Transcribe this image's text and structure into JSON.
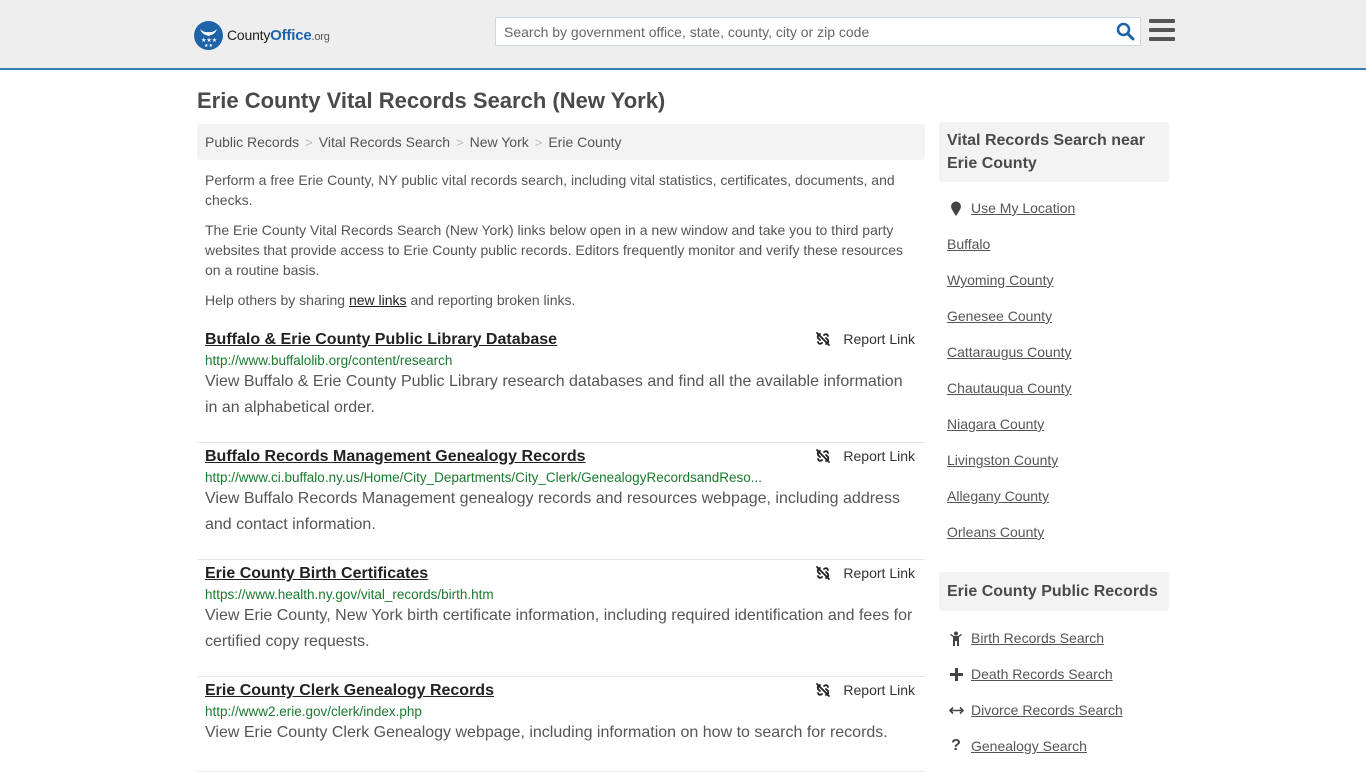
{
  "header": {
    "logo": {
      "county": "County",
      "office": "Office",
      "org": ".org"
    },
    "search_placeholder": "Search by government office, state, county, city or zip code"
  },
  "page_title": "Erie County Vital Records Search (New York)",
  "breadcrumb": [
    "Public Records",
    "Vital Records Search",
    "New York",
    "Erie County"
  ],
  "intro": {
    "p1": "Perform a free Erie County, NY public vital records search, including vital statistics, certificates, documents, and checks.",
    "p2": "The Erie County Vital Records Search (New York) links below open in a new window and take you to third party websites that provide access to Erie County public records. Editors frequently monitor and verify these resources on a routine basis.",
    "p3_before": "Help others by sharing ",
    "p3_link": "new links",
    "p3_after": " and reporting broken links."
  },
  "report_label": "Report Link",
  "results": [
    {
      "title": "Buffalo & Erie County Public Library Database",
      "url": "http://www.buffalolib.org/content/research",
      "description": "View Buffalo & Erie County Public Library research databases and find all the available information in an alphabetical order."
    },
    {
      "title": "Buffalo Records Management Genealogy Records",
      "url": "http://www.ci.buffalo.ny.us/Home/City_Departments/City_Clerk/GenealogyRecordsandReso...",
      "description": "View Buffalo Records Management genealogy records and resources webpage, including address and contact information."
    },
    {
      "title": "Erie County Birth Certificates",
      "url": "https://www.health.ny.gov/vital_records/birth.htm",
      "description": "View Erie County, New York birth certificate information, including required identification and fees for certified copy requests."
    },
    {
      "title": "Erie County Clerk Genealogy Records",
      "url": "http://www2.erie.gov/clerk/index.php",
      "description": "View Erie County Clerk Genealogy webpage, including information on how to search for records."
    }
  ],
  "sidebar": {
    "nearby": {
      "heading": "Vital Records Search near Erie County",
      "use_location": "Use My Location",
      "items": [
        "Buffalo",
        "Wyoming County",
        "Genesee County",
        "Cattaraugus County",
        "Chautauqua County",
        "Niagara County",
        "Livingston County",
        "Allegany County",
        "Orleans County"
      ]
    },
    "public_records": {
      "heading": "Erie County Public Records",
      "items": [
        {
          "label": "Birth Records Search",
          "icon": "child-icon"
        },
        {
          "label": "Death Records Search",
          "icon": "plus-icon"
        },
        {
          "label": "Divorce Records Search",
          "icon": "arrows-horizontal-icon"
        },
        {
          "label": "Genealogy Search",
          "icon": "question-icon"
        }
      ]
    }
  },
  "colors": {
    "brand_blue": "#1e63a8",
    "header_border": "#3a7eae",
    "url_green": "#1a7a2e"
  }
}
